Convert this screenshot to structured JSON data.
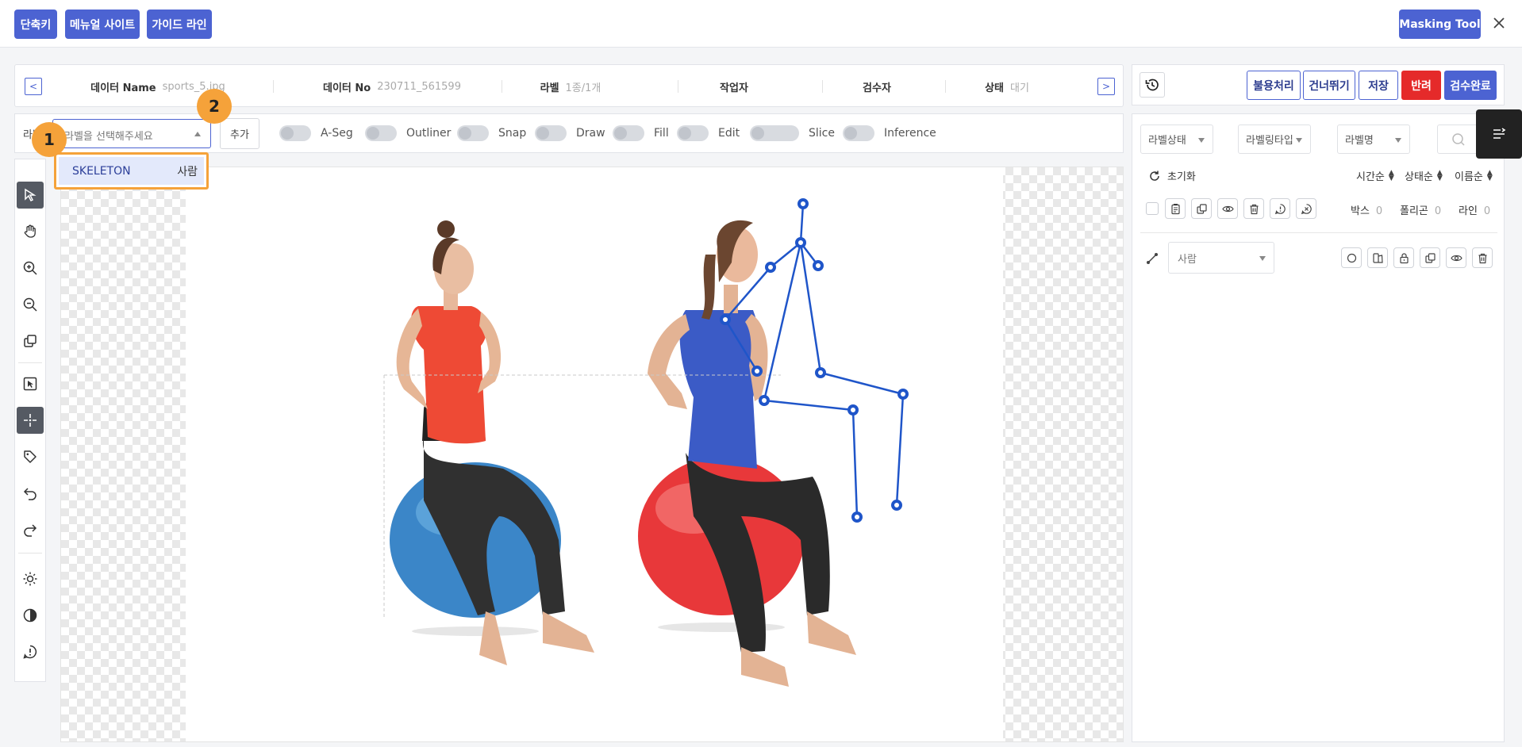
{
  "topbar": {
    "shortcut_label": "단축키",
    "manual_label": "메뉴얼 사이트",
    "guide_label": "가이드 라인",
    "masking_tool_label": "Masking Tool"
  },
  "info": {
    "data_name_key": "데이터 Name",
    "data_name_val": "sports_5.jpg",
    "data_no_key": "데이터 No",
    "data_no_val": "230711_561599",
    "label_key": "라벨",
    "label_val": "1종/1개",
    "worker_key": "작업자",
    "reviewer_key": "검수자",
    "status_key": "상태",
    "status_val": "대기",
    "prev": "<",
    "next": ">"
  },
  "toolbar": {
    "label_prefix": "라벨",
    "select_placeholder": "라벨을 선택해주세요",
    "add_label": "추가",
    "toggles": [
      "A-Seg",
      "Outliner",
      "Snap",
      "Draw",
      "Fill",
      "Edit",
      "Slice",
      "Inference"
    ]
  },
  "dropdown": {
    "option_name": "SKELETON",
    "option_class": "사람"
  },
  "badges": [
    "1",
    "2"
  ],
  "right_header": {
    "unusable": "불용처리",
    "skip": "건너뛰기",
    "save": "저장",
    "reject": "반려",
    "review_done": "검수완료"
  },
  "right_panel": {
    "filters": [
      "라벨상태",
      "라벨링타입",
      "라벨명"
    ],
    "reset": "초기화",
    "sort": [
      "시간순",
      "상태순",
      "이름순"
    ],
    "counts": [
      {
        "label": "박스",
        "value": "0"
      },
      {
        "label": "폴리곤",
        "value": "0"
      },
      {
        "label": "라인",
        "value": "0"
      }
    ],
    "class_value": "사람"
  },
  "colors": {
    "primary": "#4c63d2",
    "danger": "#e52a2a",
    "highlight": "#f5a23a",
    "skeleton": "#1f55c9"
  }
}
